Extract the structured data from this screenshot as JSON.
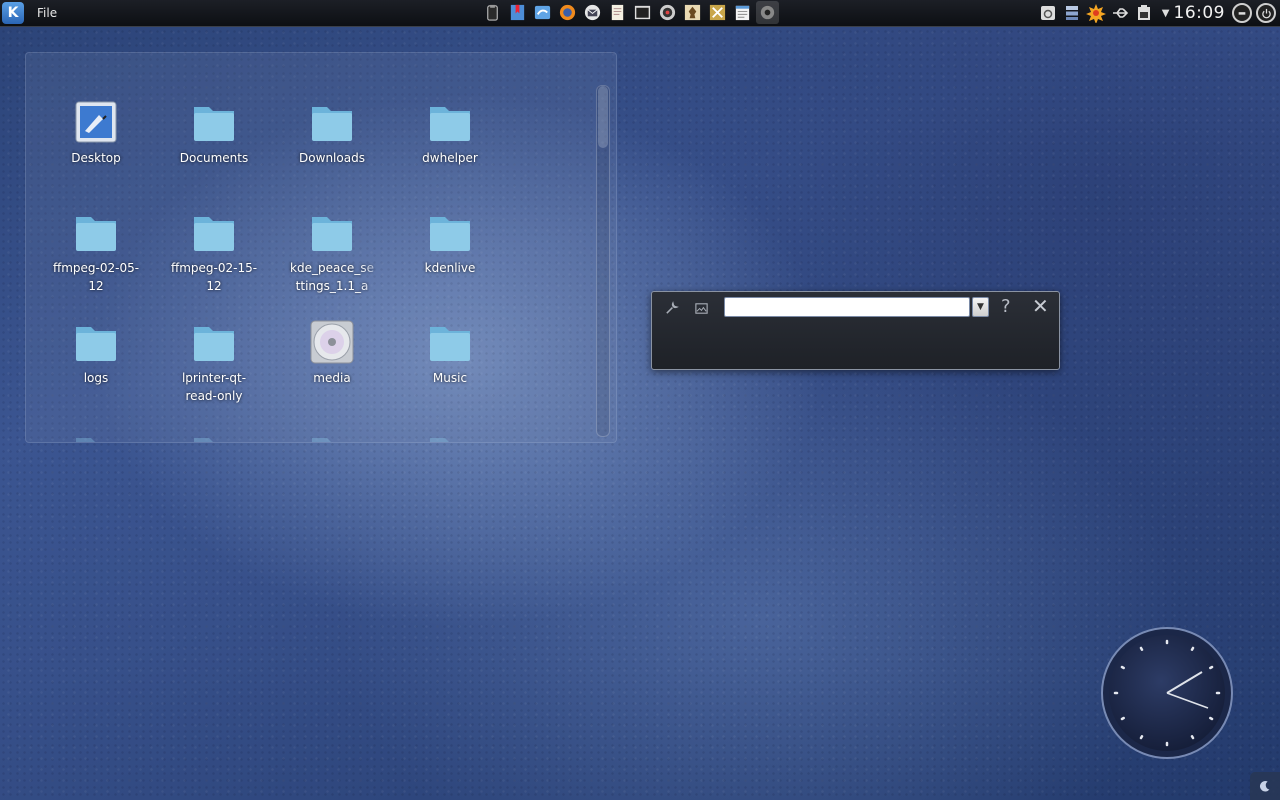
{
  "top_panel": {
    "launcher_glyph": "K",
    "menu": {
      "file_label": "File"
    },
    "taskbar": [
      "clipboard-icon",
      "bookmarks-icon",
      "messenger-icon",
      "firefox-icon",
      "mail-icon",
      "document-icon",
      "terminal-icon",
      "media-player-icon",
      "chess-icon",
      "tools-icon",
      "notes-icon",
      "network-icon"
    ],
    "tray": [
      "phone-icon",
      "window-list-icon",
      "notification-burst-icon",
      "usb-icon",
      "battery-icon"
    ],
    "time": "16:09"
  },
  "folder_view": {
    "items": [
      {
        "label": "Desktop",
        "icon": "desktop-icon"
      },
      {
        "label": "Documents",
        "icon": "folder-icon"
      },
      {
        "label": "Downloads",
        "icon": "folder-icon"
      },
      {
        "label": "dwhelper",
        "icon": "folder-icon"
      },
      {
        "label": "ffmpeg-02-05-12",
        "icon": "folder-icon"
      },
      {
        "label": "ffmpeg-02-15-12",
        "icon": "folder-icon"
      },
      {
        "label": "kde_peace_settings_1.1_a",
        "icon": "folder-icon"
      },
      {
        "label": "kdenlive",
        "icon": "folder-icon"
      },
      {
        "label": "logs",
        "icon": "folder-icon"
      },
      {
        "label": "lprinter-qt-read-only",
        "icon": "folder-icon"
      },
      {
        "label": "media",
        "icon": "cd-icon"
      },
      {
        "label": "Music",
        "icon": "folder-icon"
      }
    ]
  },
  "krunner": {
    "query": "",
    "help_glyph": "?",
    "close_glyph": "✕"
  },
  "colors": {
    "folder": "#8ecbe8",
    "panel": "#14171c",
    "accent": "#2a65b5"
  }
}
